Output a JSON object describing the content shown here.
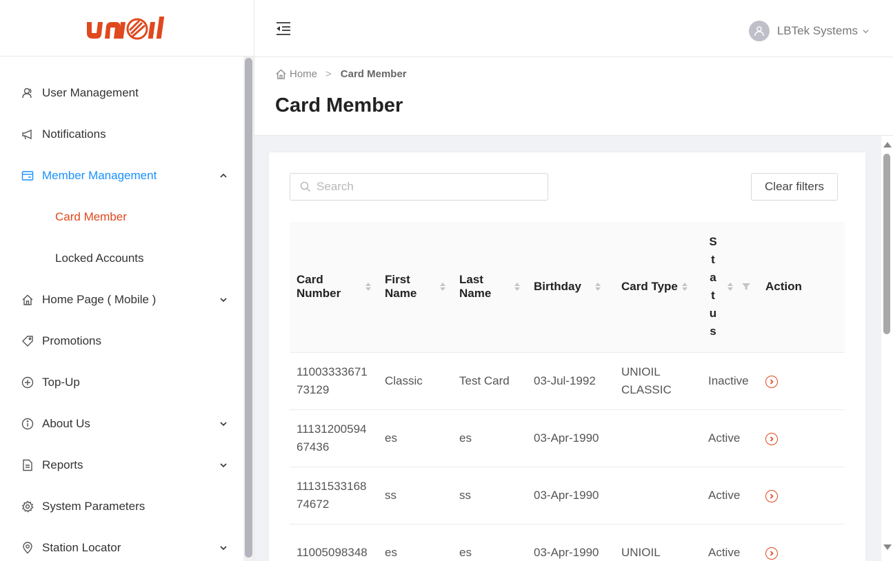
{
  "brand": {
    "logo_text": "Unioil",
    "accent": "#e0481e",
    "primary": "#1890ff"
  },
  "sidebar": {
    "items": [
      {
        "label": "User Management",
        "icon": "user-icon",
        "expandable": false
      },
      {
        "label": "Notifications",
        "icon": "megaphone-icon",
        "expandable": false
      },
      {
        "label": "Member Management",
        "icon": "card-icon",
        "expandable": true,
        "expanded": true
      },
      {
        "label": "Card Member",
        "sub": true,
        "selected": true
      },
      {
        "label": "Locked Accounts",
        "sub": true
      },
      {
        "label": "Home Page ( Mobile )",
        "icon": "home-icon",
        "expandable": true
      },
      {
        "label": "Promotions",
        "icon": "tag-icon",
        "expandable": false
      },
      {
        "label": "Top-Up",
        "icon": "plus-circle-icon",
        "expandable": false
      },
      {
        "label": "About Us",
        "icon": "info-icon",
        "expandable": true
      },
      {
        "label": "Reports",
        "icon": "file-icon",
        "expandable": true
      },
      {
        "label": "System Parameters",
        "icon": "gear-icon",
        "expandable": false
      },
      {
        "label": "Station Locator",
        "icon": "location-icon",
        "expandable": true
      }
    ]
  },
  "header": {
    "user_name": "LBTek Systems"
  },
  "breadcrumb": {
    "home": "Home",
    "current": "Card Member"
  },
  "page": {
    "title": "Card Member"
  },
  "search": {
    "placeholder": "Search",
    "value": ""
  },
  "clear_filters_label": "Clear filters",
  "table": {
    "columns": {
      "card_number": [
        "Card",
        "Number"
      ],
      "first_name": [
        "First",
        "Name"
      ],
      "last_name": [
        "Last",
        "Name"
      ],
      "birthday": "Birthday",
      "card_type": "Card Type",
      "status": [
        "S",
        "t",
        "a",
        "t",
        "u",
        "s"
      ],
      "action": "Action"
    },
    "rows": [
      {
        "card_number": [
          "11003333671",
          "73129"
        ],
        "first_name": "Classic",
        "last_name": "Test Card",
        "birthday": "03-Jul-1992",
        "card_type": [
          "UNIOIL",
          "CLASSIC"
        ],
        "status": "Inactive"
      },
      {
        "card_number": [
          "11131200594",
          "67436"
        ],
        "first_name": "es",
        "last_name": "es",
        "birthday": "03-Apr-1990",
        "card_type": [
          "",
          ""
        ],
        "status": "Active"
      },
      {
        "card_number": [
          "11131533168",
          "74672"
        ],
        "first_name": "ss",
        "last_name": "ss",
        "birthday": "03-Apr-1990",
        "card_type": [
          "",
          ""
        ],
        "status": "Active"
      },
      {
        "card_number": [
          "11005098348",
          ""
        ],
        "first_name": "es",
        "last_name": "es",
        "birthday": "03-Apr-1990",
        "card_type": [
          "UNIOIL",
          ""
        ],
        "status": "Active"
      }
    ]
  }
}
